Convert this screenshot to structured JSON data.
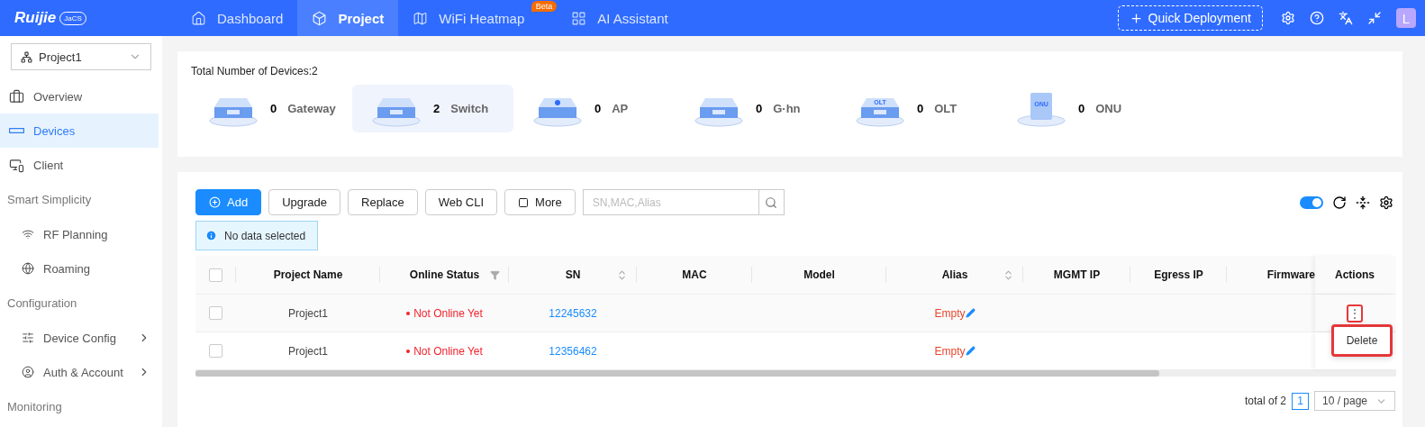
{
  "header": {
    "logo": {
      "brand": "Ruijie",
      "badge": "JaCS"
    },
    "nav": [
      {
        "label": "Dashboard",
        "selected": false
      },
      {
        "label": "Project",
        "selected": true
      },
      {
        "label": "WiFi Heatmap",
        "selected": false,
        "badge": "Beta"
      },
      {
        "label": "AI Assistant",
        "selected": false
      }
    ],
    "quick_deployment": "Quick Deployment",
    "avatar": "L"
  },
  "sidebar": {
    "project_select": "Project1",
    "items": [
      {
        "kind": "item",
        "label": "Overview",
        "selected": false
      },
      {
        "kind": "item",
        "label": "Devices",
        "selected": true
      },
      {
        "kind": "item",
        "label": "Client",
        "selected": false
      },
      {
        "kind": "section",
        "label": "Smart Simplicity"
      },
      {
        "kind": "sub",
        "label": "RF Planning",
        "selected": false,
        "expandable": false
      },
      {
        "kind": "sub",
        "label": "Roaming",
        "selected": false,
        "expandable": false
      },
      {
        "kind": "section",
        "label": "Configuration"
      },
      {
        "kind": "sub",
        "label": "Device Config",
        "selected": false,
        "expandable": true
      },
      {
        "kind": "sub",
        "label": "Auth & Account",
        "selected": false,
        "expandable": true
      },
      {
        "kind": "section",
        "label": "Monitoring"
      }
    ]
  },
  "summary": {
    "title": "Total Number of Devices:2",
    "types": [
      {
        "kind": "box",
        "count": "0",
        "label": "Gateway",
        "selected": false
      },
      {
        "kind": "box",
        "count": "2",
        "label": "Switch",
        "selected": true
      },
      {
        "kind": "ap",
        "count": "0",
        "label": "AP",
        "selected": false
      },
      {
        "kind": "box",
        "count": "0",
        "label": "G·hn",
        "selected": false
      },
      {
        "kind": "box",
        "count": "0",
        "label": "OLT",
        "selected": false,
        "icon_text": "OLT"
      },
      {
        "kind": "tower",
        "count": "0",
        "label": "ONU",
        "selected": false,
        "icon_text": "ONU"
      }
    ]
  },
  "toolbar": {
    "buttons": [
      {
        "label": "Add",
        "primary": true
      },
      {
        "label": "Upgrade",
        "primary": false
      },
      {
        "label": "Replace",
        "primary": false
      },
      {
        "label": "Web CLI",
        "primary": false
      },
      {
        "label": "More",
        "primary": false
      }
    ],
    "search": {
      "placeholder": "SN,MAC,Alias"
    },
    "auto_refresh_on": true
  },
  "notice": "No data selected",
  "table": {
    "all_checked": false,
    "columns": [
      {
        "label": "Project Name",
        "kind": "plain"
      },
      {
        "label": "Online Status",
        "kind": "filter"
      },
      {
        "label": "SN",
        "kind": "sort"
      },
      {
        "label": "MAC",
        "kind": "plain"
      },
      {
        "label": "Model",
        "kind": "plain"
      },
      {
        "label": "Alias",
        "kind": "sort"
      },
      {
        "label": "MGMT IP",
        "kind": "plain"
      },
      {
        "label": "Egress IP",
        "kind": "plain"
      },
      {
        "label": "Firmware",
        "kind": "plain"
      },
      {
        "label": "Actions",
        "kind": "plain"
      }
    ],
    "rows": [
      {
        "checked": false,
        "project": "Project1",
        "status": "Not Online Yet",
        "sn": "12245632",
        "alias": "Empty",
        "action": "⋮"
      },
      {
        "checked": false,
        "project": "Project1",
        "status": "Not Online Yet",
        "sn": "12356462",
        "alias": "Empty"
      }
    ],
    "action_menu": {
      "items": [
        "Delete"
      ],
      "highlighted": true
    },
    "action_highlighted": true
  },
  "pagination": {
    "total": "total of 2",
    "pages": [
      {
        "label": "1",
        "selected": true
      }
    ],
    "page_size": "10 / page"
  }
}
